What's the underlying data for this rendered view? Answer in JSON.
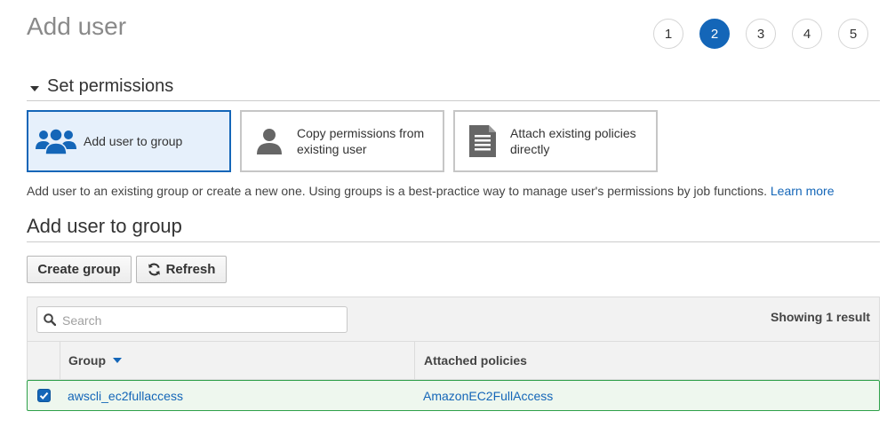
{
  "page": {
    "title": "Add user"
  },
  "steps": [
    "1",
    "2",
    "3",
    "4",
    "5"
  ],
  "active_step": "2",
  "section": {
    "title": "Set permissions"
  },
  "options": [
    {
      "label": "Add user to group",
      "icon": "group-icon",
      "selected": true
    },
    {
      "label": "Copy permissions from existing user",
      "icon": "user-icon",
      "selected": false
    },
    {
      "label": "Attach existing policies directly",
      "icon": "document-icon",
      "selected": false
    }
  ],
  "description": {
    "text": "Add user to an existing group or create a new one. Using groups is a best-practice way to manage user's permissions by job functions.",
    "link": "Learn more"
  },
  "group_section": {
    "title": "Add user to group"
  },
  "buttons": {
    "create_group": "Create group",
    "refresh": "Refresh"
  },
  "table": {
    "search_placeholder": "Search",
    "result_text": "Showing 1 result",
    "columns": [
      "Group",
      "Attached policies"
    ],
    "rows": [
      {
        "group": "awscli_ec2fullaccess",
        "policies": "AmazonEC2FullAccess",
        "checked": true
      }
    ]
  },
  "colors": {
    "accent": "#1466b8",
    "selected_row_border": "#2ea04a"
  }
}
